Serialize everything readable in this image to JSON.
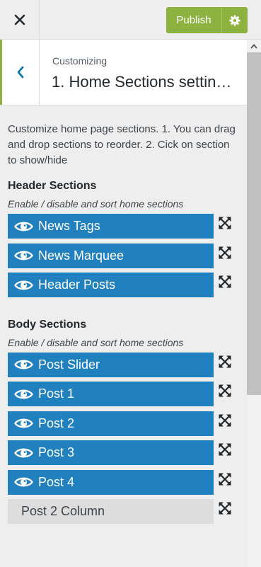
{
  "topbar": {
    "close_icon": "close-icon",
    "publish_label": "Publish",
    "settings_icon": "gear-icon",
    "accent_color": "#8db23f"
  },
  "section": {
    "back_icon": "chevron-left-icon",
    "breadcrumb": "Customizing",
    "title": "1. Home Sections settin…"
  },
  "description": "Customize home page sections. 1. You can drag and drop sections to reorder. 2. Cick on section to show/hide",
  "header_sections": {
    "title": "Header Sections",
    "subtitle": "Enable / disable and sort home sections",
    "items": [
      {
        "label": "News Tags",
        "enabled": true
      },
      {
        "label": "News Marquee",
        "enabled": true
      },
      {
        "label": "Header Posts",
        "enabled": true
      }
    ]
  },
  "body_sections": {
    "title": "Body Sections",
    "subtitle": "Enable / disable and sort home sections",
    "items": [
      {
        "label": "Post Slider",
        "enabled": true
      },
      {
        "label": "Post 1",
        "enabled": true
      },
      {
        "label": "Post 2",
        "enabled": true
      },
      {
        "label": "Post 3",
        "enabled": true
      },
      {
        "label": "Post 4",
        "enabled": true
      },
      {
        "label": "Post 2 Column",
        "enabled": false
      }
    ]
  },
  "colors": {
    "enabled_item": "#2181be",
    "disabled_item": "#dddddd"
  }
}
